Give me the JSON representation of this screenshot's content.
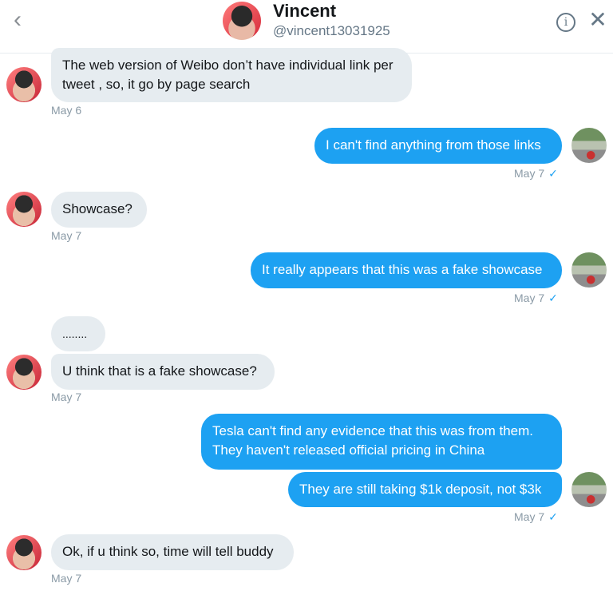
{
  "header": {
    "back_icon": "chevron-left-icon",
    "name": "Vincent",
    "handle": "@vincent13031925",
    "info_symbol": "i",
    "close_symbol": "✕"
  },
  "messages": [
    {
      "from": "Vincent",
      "text": "The web version of Weibo don’t have individual link per tweet , so, it go by page search",
      "time": "May 6"
    },
    {
      "from": "me",
      "text": "I can't find anything from those links",
      "time": "May 7",
      "read": "✓"
    },
    {
      "from": "Vincent",
      "text": "Showcase?",
      "time": "May 7"
    },
    {
      "from": "me",
      "text": "It really appears that this was a fake showcase",
      "time": "May 7",
      "read": "✓"
    },
    {
      "from": "Vincent",
      "text": "........"
    },
    {
      "from": "Vincent",
      "text": "U think that is a fake showcase?",
      "time": "May 7"
    },
    {
      "from": "me",
      "text": "Tesla can't find any evidence that this was from them. They haven't released official pricing in China"
    },
    {
      "from": "me",
      "text": "They are still taking $1k deposit, not $3k",
      "time": "May 7",
      "read": "✓"
    },
    {
      "from": "Vincent",
      "text": "Ok, if u think so, time will tell buddy",
      "time": "May 7"
    }
  ],
  "colors": {
    "sent_bubble": "#1da1f2",
    "received_bubble": "#e6ecf0",
    "timestamp": "#8a9aa6"
  }
}
